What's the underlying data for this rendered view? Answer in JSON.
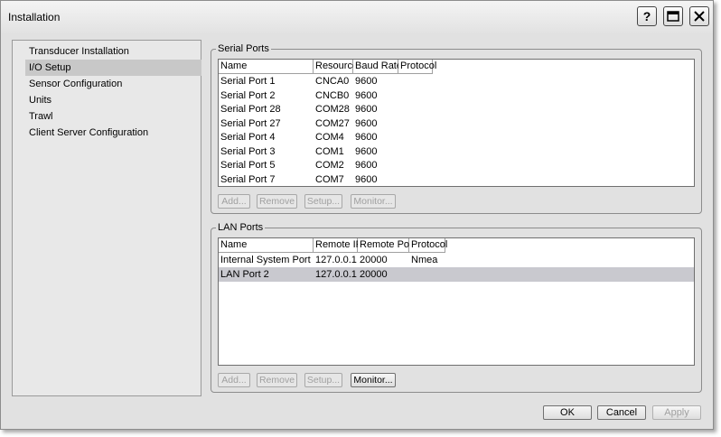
{
  "window": {
    "title": "Installation"
  },
  "titlebar": {
    "help": "?"
  },
  "nav": {
    "items": [
      {
        "label": "Transducer Installation"
      },
      {
        "label": "I/O Setup"
      },
      {
        "label": "Sensor Configuration"
      },
      {
        "label": "Units"
      },
      {
        "label": "Trawl"
      },
      {
        "label": "Client Server Configuration"
      }
    ],
    "selected": "I/O Setup"
  },
  "serial": {
    "title": "Serial Ports",
    "columns": [
      "Name",
      "Resource",
      "Baud Rate",
      "Protocol"
    ],
    "rows": [
      [
        "Serial Port 1",
        "CNCA0",
        "9600",
        ""
      ],
      [
        "Serial Port 2",
        "CNCB0",
        "9600",
        ""
      ],
      [
        "Serial Port 28",
        "COM28",
        "9600",
        ""
      ],
      [
        "Serial Port 27",
        "COM27",
        "9600",
        ""
      ],
      [
        "Serial Port 4",
        "COM4",
        "9600",
        ""
      ],
      [
        "Serial Port 3",
        "COM1",
        "9600",
        ""
      ],
      [
        "Serial Port 5",
        "COM2",
        "9600",
        ""
      ],
      [
        "Serial Port 7",
        "COM7",
        "9600",
        ""
      ]
    ],
    "buttons": {
      "add": "Add...",
      "remove": "Remove",
      "setup": "Setup...",
      "monitor": "Monitor..."
    }
  },
  "lan": {
    "title": "LAN Ports",
    "columns": [
      "Name",
      "Remote IP",
      "Remote Port",
      "Protocol"
    ],
    "rows": [
      [
        "Internal System Port",
        "127.0.0.1",
        "20000",
        "Nmea"
      ],
      [
        "LAN Port 2",
        "127.0.0.1",
        "20000",
        ""
      ]
    ],
    "buttons": {
      "add": "Add...",
      "remove": "Remove",
      "setup": "Setup...",
      "monitor": "Monitor..."
    }
  },
  "dialog": {
    "ok": "OK",
    "cancel": "Cancel",
    "apply": "Apply"
  }
}
